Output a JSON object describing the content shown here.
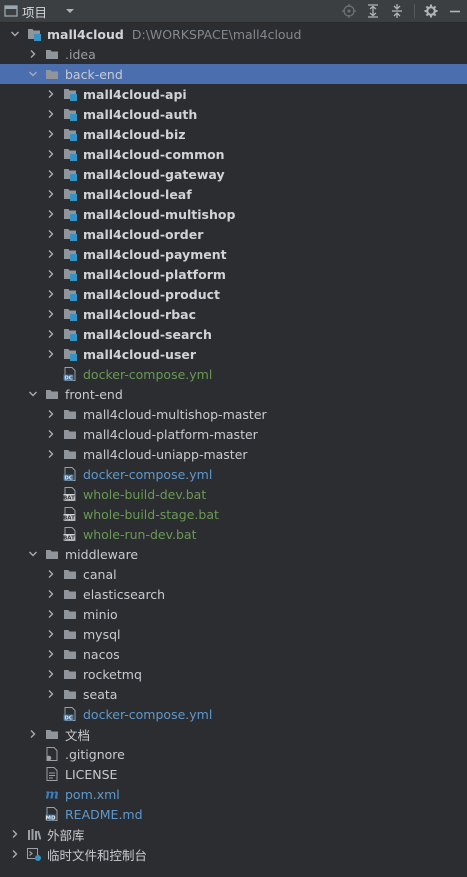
{
  "header": {
    "title": "项目"
  },
  "tree": [
    {
      "label": "mall4cloud",
      "path": "D:\\WORKSPACE\\mall4cloud",
      "depth": 0,
      "arrow": "down",
      "icon": "module",
      "style": "bold"
    },
    {
      "label": ".idea",
      "depth": 1,
      "arrow": "right",
      "icon": "folder",
      "style": "dim"
    },
    {
      "label": "back-end",
      "depth": 1,
      "arrow": "down",
      "icon": "folder",
      "style": "normal",
      "selected": true
    },
    {
      "label": "mall4cloud-api",
      "depth": 2,
      "arrow": "right",
      "icon": "module",
      "style": "bold"
    },
    {
      "label": "mall4cloud-auth",
      "depth": 2,
      "arrow": "right",
      "icon": "module",
      "style": "bold"
    },
    {
      "label": "mall4cloud-biz",
      "depth": 2,
      "arrow": "right",
      "icon": "module",
      "style": "bold"
    },
    {
      "label": "mall4cloud-common",
      "depth": 2,
      "arrow": "right",
      "icon": "module",
      "style": "bold"
    },
    {
      "label": "mall4cloud-gateway",
      "depth": 2,
      "arrow": "right",
      "icon": "module",
      "style": "bold"
    },
    {
      "label": "mall4cloud-leaf",
      "depth": 2,
      "arrow": "right",
      "icon": "module",
      "style": "bold"
    },
    {
      "label": "mall4cloud-multishop",
      "depth": 2,
      "arrow": "right",
      "icon": "module",
      "style": "bold"
    },
    {
      "label": "mall4cloud-order",
      "depth": 2,
      "arrow": "right",
      "icon": "module",
      "style": "bold"
    },
    {
      "label": "mall4cloud-payment",
      "depth": 2,
      "arrow": "right",
      "icon": "module",
      "style": "bold"
    },
    {
      "label": "mall4cloud-platform",
      "depth": 2,
      "arrow": "right",
      "icon": "module",
      "style": "bold"
    },
    {
      "label": "mall4cloud-product",
      "depth": 2,
      "arrow": "right",
      "icon": "module",
      "style": "bold"
    },
    {
      "label": "mall4cloud-rbac",
      "depth": 2,
      "arrow": "right",
      "icon": "module",
      "style": "bold"
    },
    {
      "label": "mall4cloud-search",
      "depth": 2,
      "arrow": "right",
      "icon": "module",
      "style": "bold"
    },
    {
      "label": "mall4cloud-user",
      "depth": 2,
      "arrow": "right",
      "icon": "module",
      "style": "bold"
    },
    {
      "label": "docker-compose.yml",
      "depth": 2,
      "arrow": "none",
      "icon": "dc",
      "style": "green"
    },
    {
      "label": "front-end",
      "depth": 1,
      "arrow": "down",
      "icon": "folder",
      "style": "normal"
    },
    {
      "label": "mall4cloud-multishop-master",
      "depth": 2,
      "arrow": "right",
      "icon": "folder",
      "style": "normal"
    },
    {
      "label": "mall4cloud-platform-master",
      "depth": 2,
      "arrow": "right",
      "icon": "folder",
      "style": "normal"
    },
    {
      "label": "mall4cloud-uniapp-master",
      "depth": 2,
      "arrow": "right",
      "icon": "folder",
      "style": "normal"
    },
    {
      "label": "docker-compose.yml",
      "depth": 2,
      "arrow": "none",
      "icon": "dc",
      "style": "blue"
    },
    {
      "label": "whole-build-dev.bat",
      "depth": 2,
      "arrow": "none",
      "icon": "bat",
      "style": "green"
    },
    {
      "label": "whole-build-stage.bat",
      "depth": 2,
      "arrow": "none",
      "icon": "bat",
      "style": "green"
    },
    {
      "label": "whole-run-dev.bat",
      "depth": 2,
      "arrow": "none",
      "icon": "bat",
      "style": "green"
    },
    {
      "label": "middleware",
      "depth": 1,
      "arrow": "down",
      "icon": "folder",
      "style": "normal"
    },
    {
      "label": "canal",
      "depth": 2,
      "arrow": "right",
      "icon": "folder",
      "style": "normal"
    },
    {
      "label": "elasticsearch",
      "depth": 2,
      "arrow": "right",
      "icon": "folder",
      "style": "normal"
    },
    {
      "label": "minio",
      "depth": 2,
      "arrow": "right",
      "icon": "folder",
      "style": "normal"
    },
    {
      "label": "mysql",
      "depth": 2,
      "arrow": "right",
      "icon": "folder",
      "style": "normal"
    },
    {
      "label": "nacos",
      "depth": 2,
      "arrow": "right",
      "icon": "folder",
      "style": "normal"
    },
    {
      "label": "rocketmq",
      "depth": 2,
      "arrow": "right",
      "icon": "folder",
      "style": "normal"
    },
    {
      "label": "seata",
      "depth": 2,
      "arrow": "right",
      "icon": "folder",
      "style": "normal"
    },
    {
      "label": "docker-compose.yml",
      "depth": 2,
      "arrow": "none",
      "icon": "dc",
      "style": "blue"
    },
    {
      "label": "文档",
      "depth": 1,
      "arrow": "right",
      "icon": "folder",
      "style": "normal"
    },
    {
      "label": ".gitignore",
      "depth": 1,
      "arrow": "none",
      "icon": "gitignore",
      "style": "normal"
    },
    {
      "label": "LICENSE",
      "depth": 1,
      "arrow": "none",
      "icon": "text",
      "style": "normal"
    },
    {
      "label": "pom.xml",
      "depth": 1,
      "arrow": "none",
      "icon": "maven",
      "style": "blue"
    },
    {
      "label": "README.md",
      "depth": 1,
      "arrow": "none",
      "icon": "md",
      "style": "blue"
    },
    {
      "label": "外部库",
      "depth": 0,
      "arrow": "right",
      "icon": "library",
      "style": "normal"
    },
    {
      "label": "临时文件和控制台",
      "depth": 0,
      "arrow": "right",
      "icon": "scratch",
      "style": "normal"
    }
  ]
}
